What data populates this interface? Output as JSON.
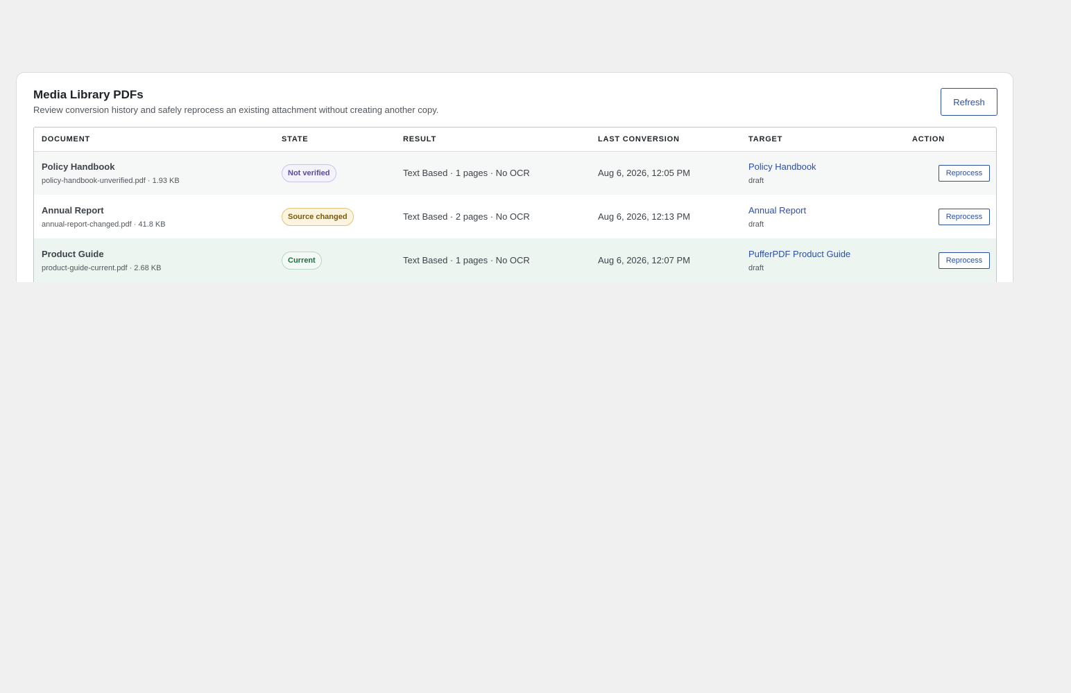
{
  "panel": {
    "title": "Media Library PDFs",
    "description": "Review conversion history and safely reprocess an existing attachment without creating another copy.",
    "refresh_label": "Refresh"
  },
  "table": {
    "headers": [
      "DOCUMENT",
      "STATE",
      "RESULT",
      "LAST CONVERSION",
      "TARGET",
      "ACTION"
    ],
    "rows": [
      {
        "title": "Policy Handbook",
        "meta": "policy-handbook-unverified.pdf · 1.93 KB",
        "state": "Not verified",
        "state_color": "#5b4a9b",
        "result": "Text Based · 1 pages · No OCR",
        "last_conversion": "Aug 6, 2026, 12:05 PM",
        "target_title": "Policy Handbook",
        "target_status": "draft",
        "action_label": "Reprocess"
      },
      {
        "title": "Annual Report",
        "meta": "annual-report-changed.pdf · 41.8 KB",
        "state": "Source changed",
        "state_color": "#7a5a0c",
        "result": "Text Based · 2 pages · No OCR",
        "last_conversion": "Aug 6, 2026, 12:13 PM",
        "target_title": "Annual Report",
        "target_status": "draft",
        "action_label": "Reprocess"
      },
      {
        "title": "Product Guide",
        "meta": "product-guide-current.pdf · 2.68 KB",
        "state": "Current",
        "state_color": "#1f6b3d",
        "result": "Text Based · 1 pages · No OCR",
        "last_conversion": "Aug 6, 2026, 12:07 PM",
        "target_title": "PufferPDF Product Guide",
        "target_status": "draft",
        "action_label": "Reprocess"
      }
    ]
  },
  "colors": {
    "accent": "#2c4fa5",
    "background": "#f0f0f1"
  }
}
